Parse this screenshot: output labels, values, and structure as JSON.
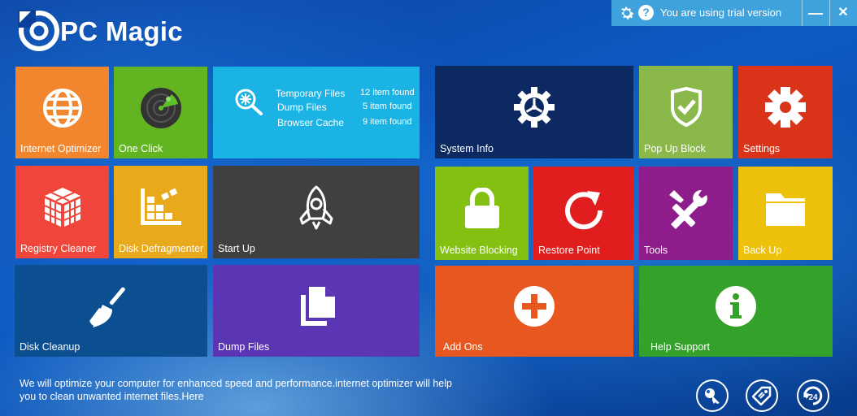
{
  "app": {
    "title": "PC Magic"
  },
  "trial_bar": {
    "message": "You are using trial version",
    "help_symbol": "?",
    "minimize_symbol": "—",
    "close_symbol": "✕"
  },
  "tiles": {
    "internet_optimizer": {
      "label": "Internet Optimizer",
      "color": "#f1862e",
      "icon": "globe-icon"
    },
    "one_click": {
      "label": "One Click",
      "color": "#62b521",
      "icon": "radar-icon"
    },
    "registry_cleaner": {
      "label": "Registry Cleaner",
      "color": "#f0453a",
      "icon": "cubes-icon"
    },
    "disk_defragmenter": {
      "label": "Disk Defragmenter",
      "color": "#e8a91c",
      "icon": "defrag-icon"
    },
    "disk_cleanup": {
      "label": "Disk Cleanup",
      "color": "#0c4f90",
      "icon": "broom-icon"
    },
    "start_up": {
      "label": "Start Up",
      "color": "#404040",
      "icon": "rocket-icon"
    },
    "dump_files": {
      "label": "Dump Files",
      "color": "#5a36b5",
      "icon": "documents-icon"
    },
    "system_info": {
      "label": "System Info",
      "color": "#0c2a61",
      "icon": "gear-icon"
    },
    "pop_up_block": {
      "label": "Pop Up Block",
      "color": "#8ab84a",
      "icon": "shield-check-icon"
    },
    "settings": {
      "label": "Settings",
      "color": "#d9341a",
      "icon": "gear-icon"
    },
    "website_blocking": {
      "label": "Website Blocking",
      "color": "#83c011",
      "icon": "lock-icon"
    },
    "restore_point": {
      "label": "Restore Point",
      "color": "#e01e1e",
      "icon": "refresh-icon"
    },
    "tools": {
      "label": "Tools",
      "color": "#8e1c8a",
      "icon": "tools-icon"
    },
    "back_up": {
      "label": "Back Up",
      "color": "#eec20c",
      "icon": "folder-icon"
    },
    "add_ons": {
      "label": "Add Ons",
      "color": "#e8571f",
      "icon": "plus-icon"
    },
    "help_support": {
      "label": "Help Support",
      "color": "#34a12a",
      "icon": "info-icon"
    }
  },
  "scan_tile": {
    "color": "#1bb3e4",
    "rows": [
      {
        "name": "Temporary Files",
        "count": "12 item found"
      },
      {
        "name": "Dump Files",
        "count": "5 item found"
      },
      {
        "name": "Browser Cache",
        "count": "9 item found"
      }
    ]
  },
  "footer": {
    "description": "We will optimize your computer for enhanced speed and performance.internet optimizer will help you to clean unwanted internet files.Here",
    "support_badge": "24"
  }
}
